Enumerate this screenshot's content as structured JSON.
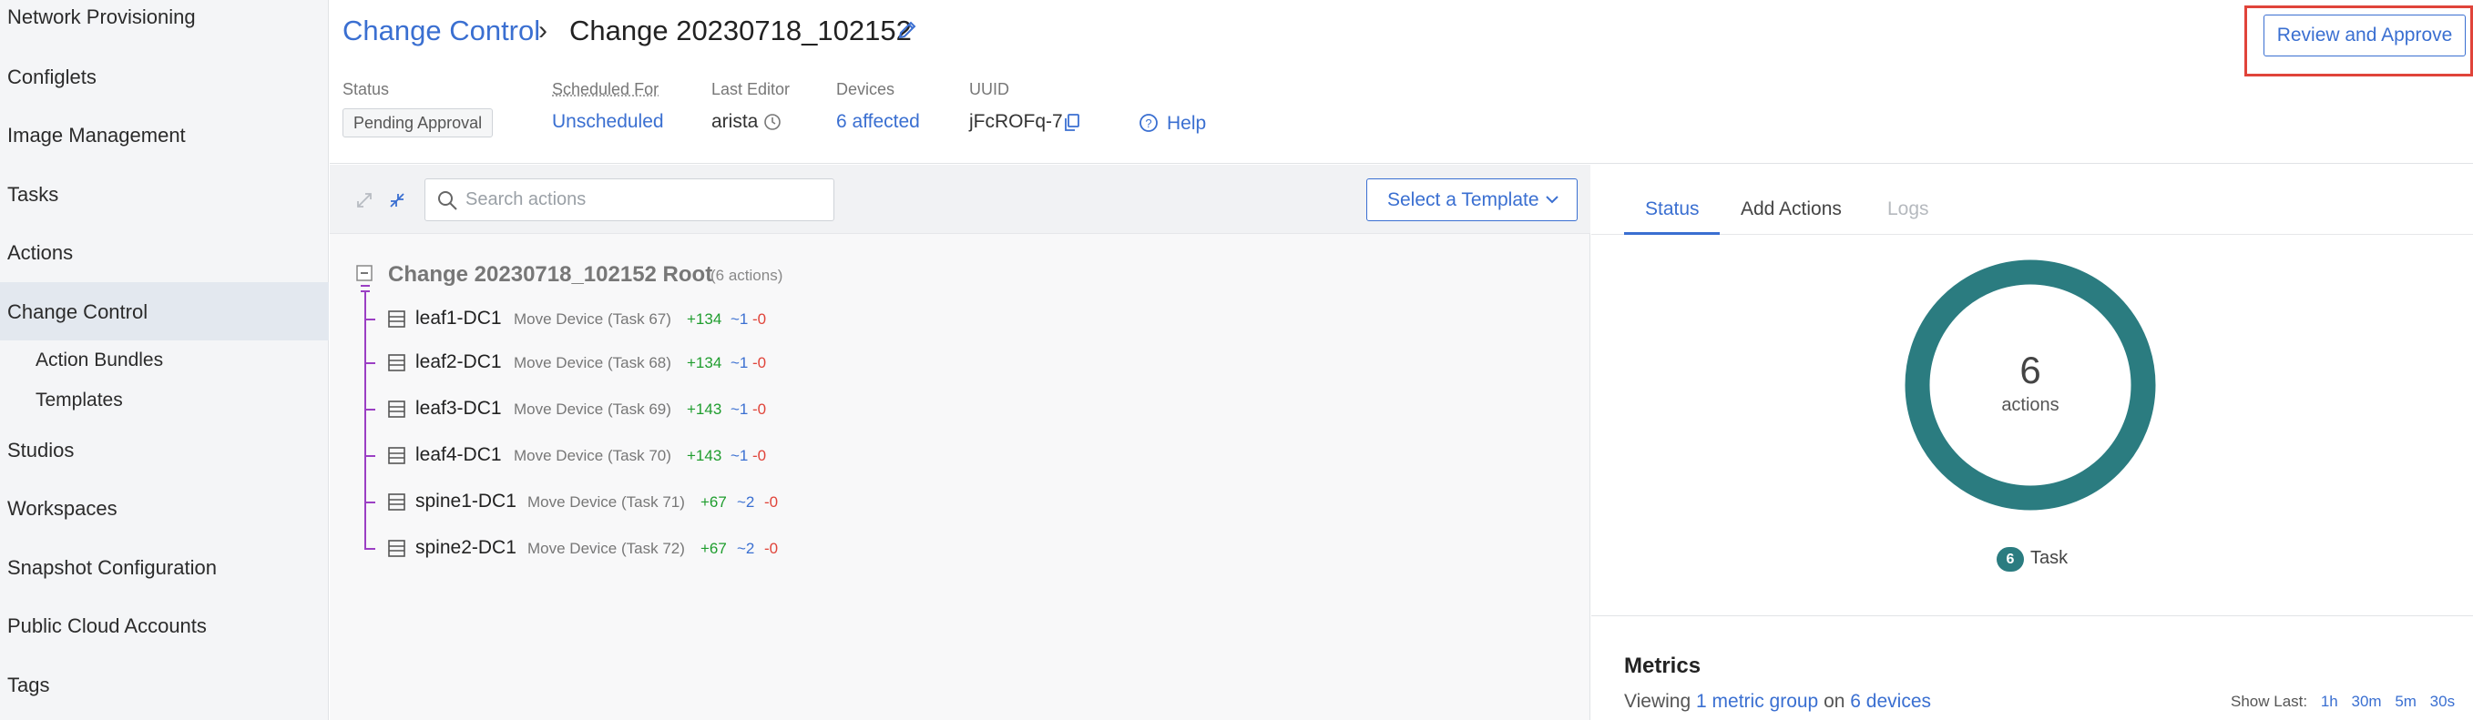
{
  "sidebar": {
    "items": [
      {
        "label": "Network Provisioning"
      },
      {
        "label": "Configlets"
      },
      {
        "label": "Image Management"
      },
      {
        "label": "Tasks"
      },
      {
        "label": "Actions"
      },
      {
        "label": "Change Control"
      },
      {
        "label": "Action Bundles"
      },
      {
        "label": "Templates"
      },
      {
        "label": "Studios"
      },
      {
        "label": "Workspaces"
      },
      {
        "label": "Snapshot Configuration"
      },
      {
        "label": "Public Cloud Accounts"
      },
      {
        "label": "Tags"
      }
    ],
    "active": "Change Control"
  },
  "header": {
    "breadcrumb_link": "Change Control",
    "title": "Change 20230718_102152",
    "review_button": "Review and Approve",
    "meta": {
      "status_label": "Status",
      "status_value": "Pending Approval",
      "scheduled_label": "Scheduled For",
      "scheduled_value": "Unscheduled",
      "editor_label": "Last Editor",
      "editor_value": "arista",
      "devices_label": "Devices",
      "devices_value": "6 affected",
      "uuid_label": "UUID",
      "uuid_value": "jFcROFq-7",
      "help": "Help"
    }
  },
  "toolbar": {
    "search_placeholder": "Search actions",
    "template_button": "Select a Template"
  },
  "tree": {
    "root_label": "Change 20230718_102152 Root",
    "root_count": "(6 actions)",
    "rows": [
      {
        "name": "leaf1-DC1",
        "action": "Move Device (Task 67)",
        "add": "+134",
        "mod": "~1",
        "del": "-0"
      },
      {
        "name": "leaf2-DC1",
        "action": "Move Device (Task 68)",
        "add": "+134",
        "mod": "~1",
        "del": "-0"
      },
      {
        "name": "leaf3-DC1",
        "action": "Move Device (Task 69)",
        "add": "+143",
        "mod": "~1",
        "del": "-0"
      },
      {
        "name": "leaf4-DC1",
        "action": "Move Device (Task 70)",
        "add": "+143",
        "mod": "~1",
        "del": "-0"
      },
      {
        "name": "spine1-DC1",
        "action": "Move Device (Task 71)",
        "add": "+67",
        "mod": "~2",
        "del": "-0"
      },
      {
        "name": "spine2-DC1",
        "action": "Move Device (Task 72)",
        "add": "+67",
        "mod": "~2",
        "del": "-0"
      }
    ]
  },
  "right_panel": {
    "tabs": [
      "Status",
      "Add Actions",
      "Logs"
    ],
    "active_tab": "Status",
    "donut_count": "6",
    "donut_label": "actions",
    "legend_count": "6",
    "legend_label": "Task",
    "metrics_title": "Metrics",
    "metrics_viewing": "Viewing",
    "metrics_groups": "1 metric group",
    "metrics_on": "on",
    "metrics_devices": "6 devices",
    "show_last_label": "Show Last:",
    "show_last_options": [
      "1h",
      "30m",
      "5m",
      "30s"
    ]
  },
  "colors": {
    "accent": "#3a6fd1",
    "donut": "#2b7c80",
    "add": "#1f9d2e",
    "delete": "#e0443a",
    "tree_line": "#9b3fc4",
    "highlight": "#e0443a"
  }
}
